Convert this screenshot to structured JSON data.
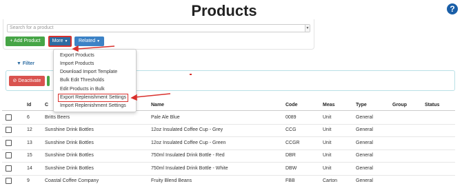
{
  "page": {
    "title": "Products"
  },
  "help_icon": "?",
  "search": {
    "placeholder": "Search for a product"
  },
  "toolbar": {
    "add_label": "+ Add Product",
    "more_label": "More",
    "related_label": "Related"
  },
  "more_menu": {
    "items": [
      "Export Products",
      "Import Products",
      "Download Import Template",
      "Bulk Edit Thresholds",
      "Edit Products in Bulk",
      "Export Replenishment Settings",
      "Import Replenishment Settings"
    ],
    "highlighted_item": "Export Replenishment Settings"
  },
  "filter_label": "Filter",
  "deactivate_label": "Deactivate",
  "table": {
    "headers": {
      "id": "Id",
      "company": "C",
      "name": "Name",
      "code": "Code",
      "meas": "Meas",
      "type": "Type",
      "group": "Group",
      "status": "Status"
    },
    "rows": [
      {
        "id": "6",
        "company": "Britts Beers",
        "name": "Pale Ale Blue",
        "code": "0089",
        "meas": "Unit",
        "type": "General"
      },
      {
        "id": "12",
        "company": "Sunshine Drink Bottles",
        "name": "12oz Insulated Coffee Cup - Grey",
        "code": "CCG",
        "meas": "Unit",
        "type": "General"
      },
      {
        "id": "13",
        "company": "Sunshine Drink Bottles",
        "name": "12oz Insulated Coffee Cup - Green",
        "code": "CCGR",
        "meas": "Unit",
        "type": "General"
      },
      {
        "id": "15",
        "company": "Sunshine Drink Bottles",
        "name": "750ml Insulated Drink Bottle - Red",
        "code": "DBR",
        "meas": "Unit",
        "type": "General"
      },
      {
        "id": "14",
        "company": "Sunshine Drink Bottles",
        "name": "750ml Insulated Drink Bottle - White",
        "code": "DBW",
        "meas": "Unit",
        "type": "General"
      },
      {
        "id": "9",
        "company": "Coastal Coffee Company",
        "name": "Fruity Blend Beans",
        "code": "FBB",
        "meas": "Carton",
        "type": "General"
      }
    ]
  },
  "colors": {
    "accent_red": "#d9302c",
    "primary_blue": "#2d6ca2",
    "success_green": "#46a546",
    "danger_red": "#d9534f"
  }
}
